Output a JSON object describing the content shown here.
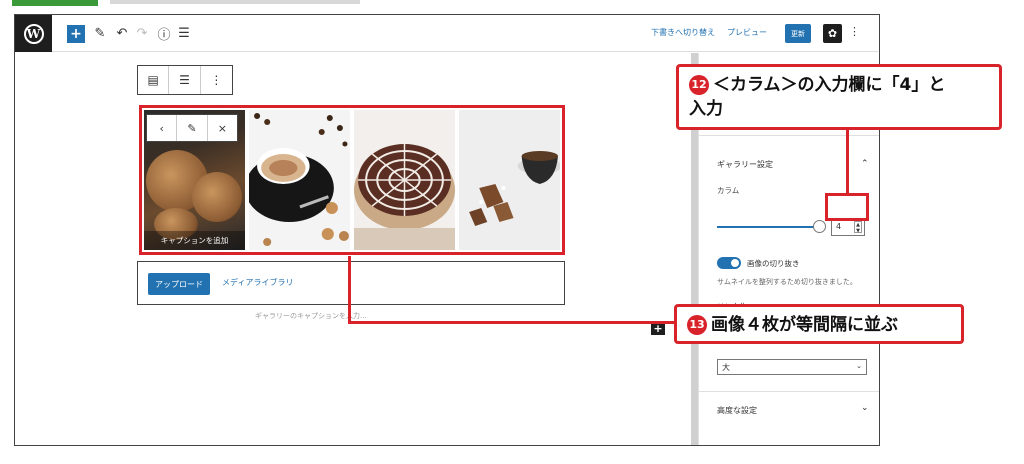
{
  "toolbar": {
    "wp_logo": "W",
    "add_icon": "+",
    "draft_link": "下書きへ切り替え",
    "preview_link": "プレビュー",
    "update_button": "更新",
    "settings_icon": "✿",
    "more_icon": "⋮"
  },
  "block_toolbar": {
    "icons": [
      "▤",
      "☰",
      "⋮"
    ]
  },
  "image_toolbar": {
    "icons": [
      "‹",
      "✎",
      "×"
    ]
  },
  "gallery": {
    "caption_placeholder": "キャプションを追加"
  },
  "uploader": {
    "upload_button": "アップロード",
    "media_library_button": "メディアライブラリ",
    "gallery_caption_placeholder": "ギャラリーのキャプションを入力..."
  },
  "sidebar": {
    "gallery_settings_title": "ギャラリー設定",
    "columns_label": "カラム",
    "columns_value": "4",
    "crop_label": "画像の切り抜き",
    "crop_help": "サムネイルを整列するため切り抜きました。",
    "link_label": "リンク先",
    "size_value": "大",
    "advanced_title": "高度な設定"
  },
  "callouts": {
    "c12_number": "12",
    "c12_text_line1": "＜カラム＞の入力欄に「4」と",
    "c12_text_line2": "入力",
    "c13_number": "13",
    "c13_text": "画像４枚が等間隔に並ぶ"
  },
  "colors": {
    "accent": "#2271b1",
    "callout_red": "#d8232a",
    "dark": "#1e1e1e"
  }
}
